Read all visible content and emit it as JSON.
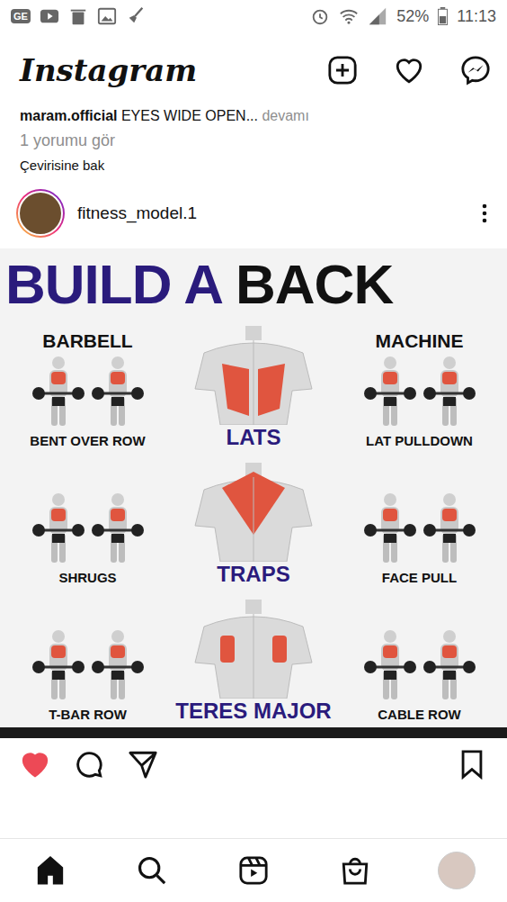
{
  "status_bar": {
    "app_badge": "GE",
    "battery": "52%",
    "time": "11:13"
  },
  "header": {
    "logo": "Instagram"
  },
  "previous_post": {
    "user": "maram.official",
    "caption": "EYES WIDE OPEN...",
    "more": "devamı",
    "comments": "1 yorumu gör",
    "translate": "Çevirisine bak"
  },
  "post": {
    "username": "fitness_model.1",
    "liked": true,
    "saved": false
  },
  "infographic": {
    "title_a": "BUILD A",
    "title_b": "BACK",
    "left_header": "BARBELL",
    "right_header": "MACHINE",
    "rows": [
      {
        "muscle": "LATS",
        "kind": "lats",
        "left": "BENT OVER ROW",
        "right": "LAT PULLDOWN"
      },
      {
        "muscle": "TRAPS",
        "kind": "traps",
        "left": "SHRUGS",
        "right": "FACE PULL"
      },
      {
        "muscle": "TERES MAJOR",
        "kind": "teres",
        "left": "T-BAR ROW",
        "right": "CABLE ROW"
      }
    ]
  },
  "nav": [
    {
      "kind": "home",
      "selected": true
    },
    {
      "kind": "search",
      "selected": false
    },
    {
      "kind": "reels",
      "selected": false
    },
    {
      "kind": "shop",
      "selected": false
    },
    {
      "kind": "profile",
      "selected": false
    }
  ]
}
